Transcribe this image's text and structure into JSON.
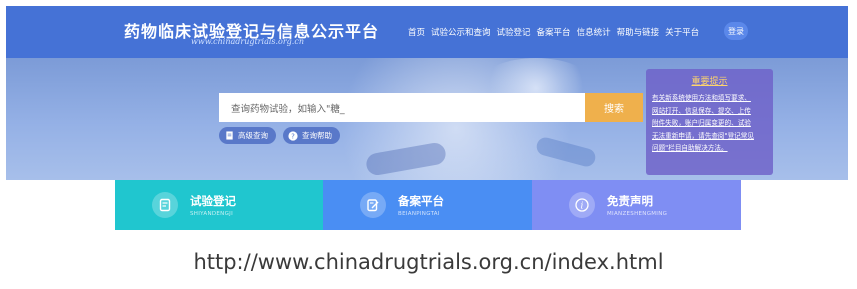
{
  "header": {
    "site_title": "药物临床试验登记与信息公示平台",
    "site_url": "www.chinadrugtrials.org.cn",
    "nav": [
      "首页",
      "试验公示和查询",
      "试验登记",
      "备案平台",
      "信息统计",
      "帮助与链接",
      "关于平台"
    ],
    "login_label": "登录"
  },
  "search": {
    "placeholder": "查询药物试验，如输入\"糖_",
    "button_label": "搜索",
    "advanced_label": "高级查询",
    "help_label": "查询帮助"
  },
  "notice": {
    "title": "重要提示",
    "lines": [
      "有关新系统使用方法和填写要求、",
      "网站打开、信息保存、提交、上传",
      "附件失败，账户归属变更的、试验",
      "无法重新申请，请先查阅\"登记常见",
      "问题\"栏目自助解决方法。"
    ]
  },
  "cards": [
    {
      "title": "试验登记",
      "subtitle": "SHIYANDENGJI",
      "icon": "form-icon"
    },
    {
      "title": "备案平台",
      "subtitle": "BEIANPINGTAI",
      "icon": "edit-doc-icon"
    },
    {
      "title": "免责声明",
      "subtitle": "MIANZESHENGMING",
      "icon": "info-icon"
    }
  ],
  "caption": "http://www.chinadrugtrials.org.cn/index.html",
  "colors": {
    "navbar": "#4572d6",
    "search_button": "#efb04c",
    "card1": "#20c6cf",
    "card2": "#4a8ef3",
    "card3": "#7f8ef3"
  }
}
